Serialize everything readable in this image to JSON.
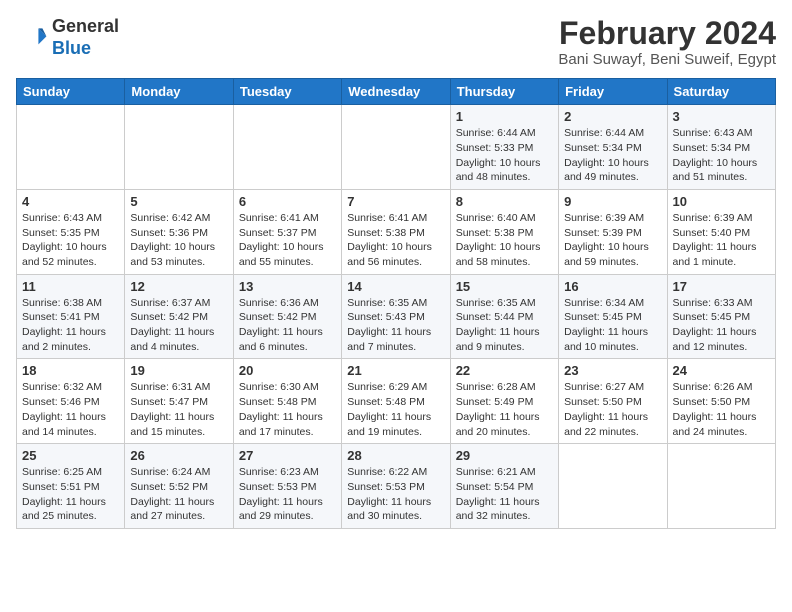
{
  "header": {
    "logo_general": "General",
    "logo_blue": "Blue",
    "month_title": "February 2024",
    "location": "Bani Suwayf, Beni Suweif, Egypt"
  },
  "days_of_week": [
    "Sunday",
    "Monday",
    "Tuesday",
    "Wednesday",
    "Thursday",
    "Friday",
    "Saturday"
  ],
  "weeks": [
    [
      {
        "day": "",
        "info": ""
      },
      {
        "day": "",
        "info": ""
      },
      {
        "day": "",
        "info": ""
      },
      {
        "day": "",
        "info": ""
      },
      {
        "day": "1",
        "info": "Sunrise: 6:44 AM\nSunset: 5:33 PM\nDaylight: 10 hours and 48 minutes."
      },
      {
        "day": "2",
        "info": "Sunrise: 6:44 AM\nSunset: 5:34 PM\nDaylight: 10 hours and 49 minutes."
      },
      {
        "day": "3",
        "info": "Sunrise: 6:43 AM\nSunset: 5:34 PM\nDaylight: 10 hours and 51 minutes."
      }
    ],
    [
      {
        "day": "4",
        "info": "Sunrise: 6:43 AM\nSunset: 5:35 PM\nDaylight: 10 hours and 52 minutes."
      },
      {
        "day": "5",
        "info": "Sunrise: 6:42 AM\nSunset: 5:36 PM\nDaylight: 10 hours and 53 minutes."
      },
      {
        "day": "6",
        "info": "Sunrise: 6:41 AM\nSunset: 5:37 PM\nDaylight: 10 hours and 55 minutes."
      },
      {
        "day": "7",
        "info": "Sunrise: 6:41 AM\nSunset: 5:38 PM\nDaylight: 10 hours and 56 minutes."
      },
      {
        "day": "8",
        "info": "Sunrise: 6:40 AM\nSunset: 5:38 PM\nDaylight: 10 hours and 58 minutes."
      },
      {
        "day": "9",
        "info": "Sunrise: 6:39 AM\nSunset: 5:39 PM\nDaylight: 10 hours and 59 minutes."
      },
      {
        "day": "10",
        "info": "Sunrise: 6:39 AM\nSunset: 5:40 PM\nDaylight: 11 hours and 1 minute."
      }
    ],
    [
      {
        "day": "11",
        "info": "Sunrise: 6:38 AM\nSunset: 5:41 PM\nDaylight: 11 hours and 2 minutes."
      },
      {
        "day": "12",
        "info": "Sunrise: 6:37 AM\nSunset: 5:42 PM\nDaylight: 11 hours and 4 minutes."
      },
      {
        "day": "13",
        "info": "Sunrise: 6:36 AM\nSunset: 5:42 PM\nDaylight: 11 hours and 6 minutes."
      },
      {
        "day": "14",
        "info": "Sunrise: 6:35 AM\nSunset: 5:43 PM\nDaylight: 11 hours and 7 minutes."
      },
      {
        "day": "15",
        "info": "Sunrise: 6:35 AM\nSunset: 5:44 PM\nDaylight: 11 hours and 9 minutes."
      },
      {
        "day": "16",
        "info": "Sunrise: 6:34 AM\nSunset: 5:45 PM\nDaylight: 11 hours and 10 minutes."
      },
      {
        "day": "17",
        "info": "Sunrise: 6:33 AM\nSunset: 5:45 PM\nDaylight: 11 hours and 12 minutes."
      }
    ],
    [
      {
        "day": "18",
        "info": "Sunrise: 6:32 AM\nSunset: 5:46 PM\nDaylight: 11 hours and 14 minutes."
      },
      {
        "day": "19",
        "info": "Sunrise: 6:31 AM\nSunset: 5:47 PM\nDaylight: 11 hours and 15 minutes."
      },
      {
        "day": "20",
        "info": "Sunrise: 6:30 AM\nSunset: 5:48 PM\nDaylight: 11 hours and 17 minutes."
      },
      {
        "day": "21",
        "info": "Sunrise: 6:29 AM\nSunset: 5:48 PM\nDaylight: 11 hours and 19 minutes."
      },
      {
        "day": "22",
        "info": "Sunrise: 6:28 AM\nSunset: 5:49 PM\nDaylight: 11 hours and 20 minutes."
      },
      {
        "day": "23",
        "info": "Sunrise: 6:27 AM\nSunset: 5:50 PM\nDaylight: 11 hours and 22 minutes."
      },
      {
        "day": "24",
        "info": "Sunrise: 6:26 AM\nSunset: 5:50 PM\nDaylight: 11 hours and 24 minutes."
      }
    ],
    [
      {
        "day": "25",
        "info": "Sunrise: 6:25 AM\nSunset: 5:51 PM\nDaylight: 11 hours and 25 minutes."
      },
      {
        "day": "26",
        "info": "Sunrise: 6:24 AM\nSunset: 5:52 PM\nDaylight: 11 hours and 27 minutes."
      },
      {
        "day": "27",
        "info": "Sunrise: 6:23 AM\nSunset: 5:53 PM\nDaylight: 11 hours and 29 minutes."
      },
      {
        "day": "28",
        "info": "Sunrise: 6:22 AM\nSunset: 5:53 PM\nDaylight: 11 hours and 30 minutes."
      },
      {
        "day": "29",
        "info": "Sunrise: 6:21 AM\nSunset: 5:54 PM\nDaylight: 11 hours and 32 minutes."
      },
      {
        "day": "",
        "info": ""
      },
      {
        "day": "",
        "info": ""
      }
    ]
  ]
}
